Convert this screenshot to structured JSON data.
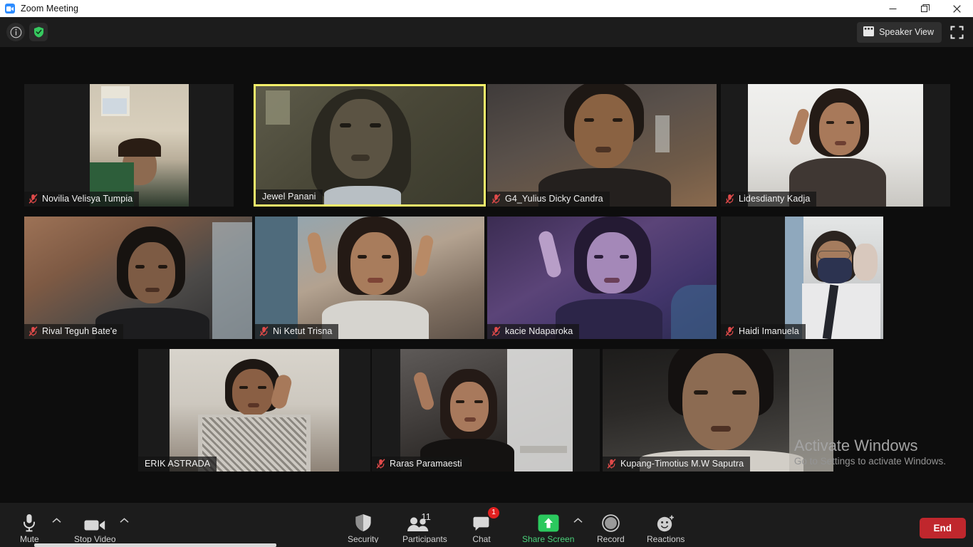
{
  "window": {
    "title": "Zoom Meeting",
    "app_icon": "zoom-camera-icon",
    "minimize": "minimize-icon",
    "maximize": "restore-icon",
    "close": "close-icon"
  },
  "topbar": {
    "info_icon": "info-icon",
    "encryption_icon": "shield-check-icon",
    "view_button": {
      "label": "Speaker View",
      "icon": "grid-view-icon"
    },
    "fullscreen_icon": "enter-fullscreen-icon"
  },
  "gallery": {
    "active_border_color": "#f5f06a",
    "participants": [
      {
        "name": "Novilia Velisya Tumpia",
        "muted": true,
        "active": false
      },
      {
        "name": "Jewel Panani",
        "muted": false,
        "active": true
      },
      {
        "name": "G4_Yulius Dicky Candra",
        "muted": true,
        "active": false
      },
      {
        "name": "Lidesdianty Kadja",
        "muted": true,
        "active": false
      },
      {
        "name": "Rival Teguh Bate'e",
        "muted": true,
        "active": false
      },
      {
        "name": "Ni Ketut Trisna",
        "muted": true,
        "active": false
      },
      {
        "name": "kacie Ndaparoka",
        "muted": true,
        "active": false
      },
      {
        "name": "Haidi Imanuela",
        "muted": true,
        "active": false
      },
      {
        "name": "ERIK ASTRADA",
        "muted": false,
        "active": false
      },
      {
        "name": "Raras Paramaesti",
        "muted": true,
        "active": false
      },
      {
        "name": "Kupang-Timotius M.W Saputra",
        "muted": true,
        "active": false
      }
    ]
  },
  "watermark": {
    "line1": "Activate Windows",
    "line2": "Go to Settings to activate Windows."
  },
  "toolbar": {
    "mute": {
      "label": "Mute",
      "icon": "microphone-icon",
      "has_chevron": true
    },
    "video": {
      "label": "Stop Video",
      "icon": "video-camera-icon",
      "has_chevron": true
    },
    "security": {
      "label": "Security",
      "icon": "shield-icon"
    },
    "participants": {
      "label": "Participants",
      "icon": "people-icon",
      "count": "11"
    },
    "chat": {
      "label": "Chat",
      "icon": "chat-bubble-icon",
      "badge": "1",
      "badge_color": "#e02020"
    },
    "share_screen": {
      "label": "Share Screen",
      "icon": "share-arrow-up-icon",
      "color": "#4ad17a",
      "has_chevron": true
    },
    "record": {
      "label": "Record",
      "icon": "record-circle-icon"
    },
    "reactions": {
      "label": "Reactions",
      "icon": "smiley-plus-icon"
    },
    "end": {
      "label": "End",
      "color": "#c0272d"
    }
  }
}
